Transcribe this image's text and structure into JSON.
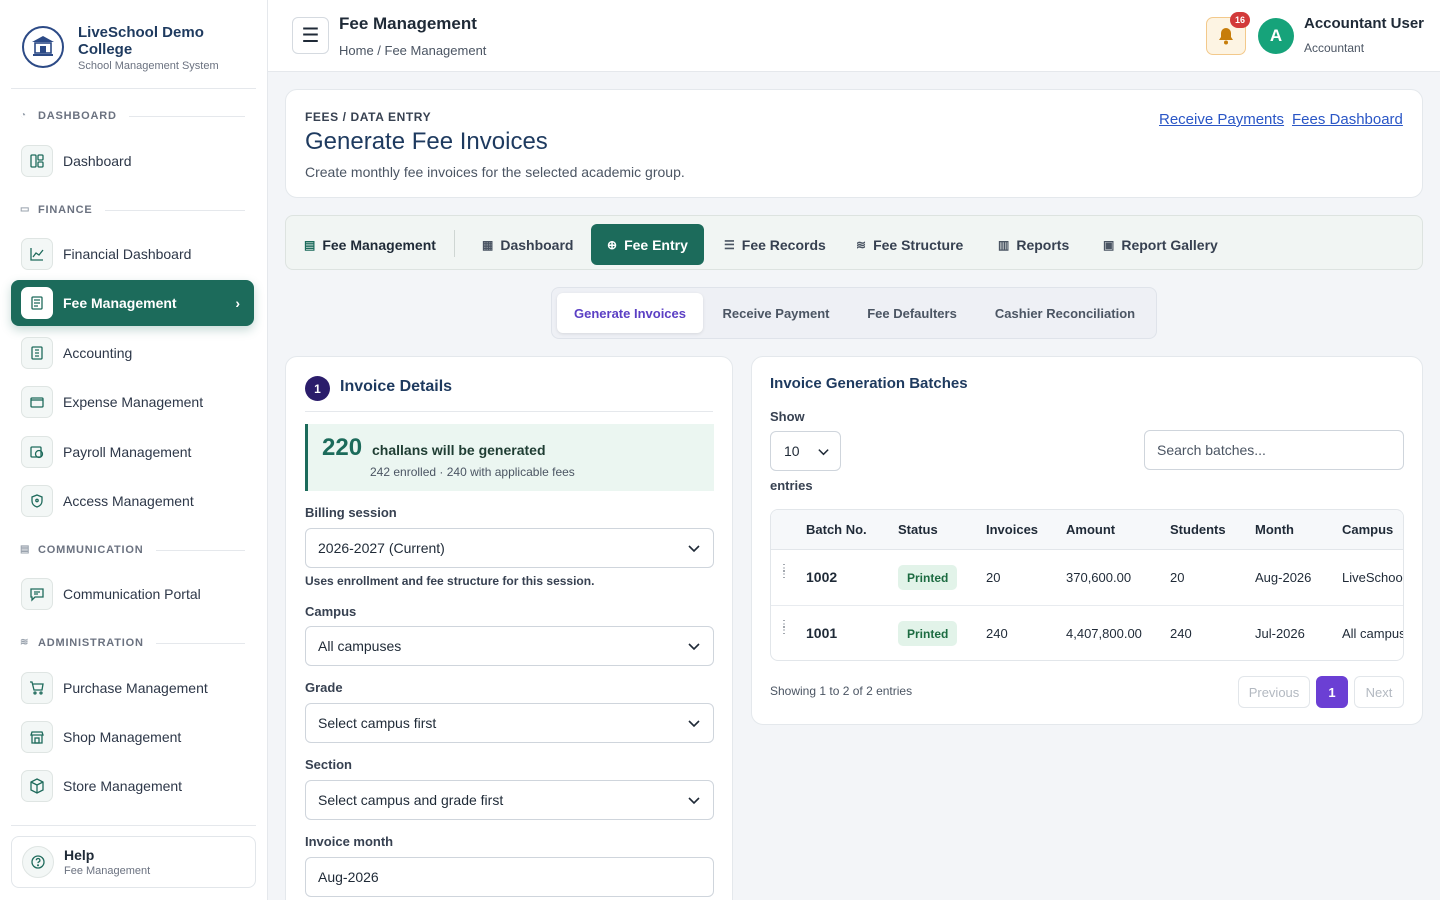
{
  "brand": {
    "name": "LiveSchool Demo College",
    "subtitle": "School Management System"
  },
  "sidebar": {
    "sections": [
      {
        "title": "DASHBOARD"
      },
      {
        "title": "FINANCE"
      },
      {
        "title": "COMMUNICATION"
      },
      {
        "title": "ADMINISTRATION"
      }
    ],
    "items": [
      {
        "label": "Dashboard",
        "icon": "dashboard-icon"
      },
      {
        "label": "Financial Dashboard",
        "icon": "chart-icon"
      },
      {
        "label": "Fee Management",
        "icon": "receipt-icon",
        "active": true
      },
      {
        "label": "Accounting",
        "icon": "ledger-icon"
      },
      {
        "label": "Expense Management",
        "icon": "wallet-icon"
      },
      {
        "label": "Payroll Management",
        "icon": "payroll-icon"
      },
      {
        "label": "Access Management",
        "icon": "shield-icon"
      },
      {
        "label": "Communication Portal",
        "icon": "message-icon"
      },
      {
        "label": "Purchase Management",
        "icon": "cart-icon"
      },
      {
        "label": "Shop Management",
        "icon": "shop-icon"
      },
      {
        "label": "Store Management",
        "icon": "box-icon"
      }
    ],
    "help": {
      "title": "Help",
      "subtitle": "Fee Management"
    }
  },
  "topbar": {
    "title": "Fee Management",
    "breadcrumb": "Home / Fee Management",
    "notifications": "16",
    "avatar_initial": "A",
    "user_name": "Accountant User",
    "user_role": "Accountant"
  },
  "header": {
    "eyebrow": "FEES / DATA ENTRY",
    "title": "Generate Fee Invoices",
    "subtitle": "Create monthly fee invoices for the selected academic group.",
    "links": [
      "Receive Payments",
      "Fees Dashboard"
    ]
  },
  "module_tabs": [
    "Fee Management",
    "Dashboard",
    "Fee Entry",
    "Fee Records",
    "Fee Structure",
    "Reports",
    "Report Gallery"
  ],
  "sub_tabs": [
    "Generate Invoices",
    "Receive Payment",
    "Fee Defaulters",
    "Cashier Reconciliation"
  ],
  "invoice": {
    "step": "1",
    "title": "Invoice Details",
    "count": "220",
    "count_text": "challans will be generated",
    "count_sub": "242 enrolled · 240 with applicable fees",
    "billing_label": "Billing session",
    "billing_value": "2026-2027 (Current)",
    "billing_hint": "Uses enrollment and fee structure for this session.",
    "campus_label": "Campus",
    "campus_value": "All campuses",
    "grade_label": "Grade",
    "grade_value": "Select campus first",
    "section_label": "Section",
    "section_value": "Select campus and grade first",
    "month_label": "Invoice month",
    "month_value": "Aug-2026"
  },
  "batches": {
    "title": "Invoice Generation Batches",
    "show_label": "Show",
    "show_value": "10",
    "entries_label": "entries",
    "search_placeholder": "Search batches...",
    "columns": [
      "Batch No.",
      "Status",
      "Invoices",
      "Amount",
      "Students",
      "Month",
      "Campus"
    ],
    "rows": [
      {
        "batch": "1002",
        "status": "Printed",
        "invoices": "20",
        "amount": "370,600.00",
        "students": "20",
        "month": "Aug-2026",
        "campus": "LiveSchool"
      },
      {
        "batch": "1001",
        "status": "Printed",
        "invoices": "240",
        "amount": "4,407,800.00",
        "students": "240",
        "month": "Jul-2026",
        "campus": "All campus"
      }
    ],
    "showing": "Showing 1 to 2 of 2 entries",
    "pagination": {
      "prev": "Previous",
      "page": "1",
      "next": "Next"
    }
  }
}
